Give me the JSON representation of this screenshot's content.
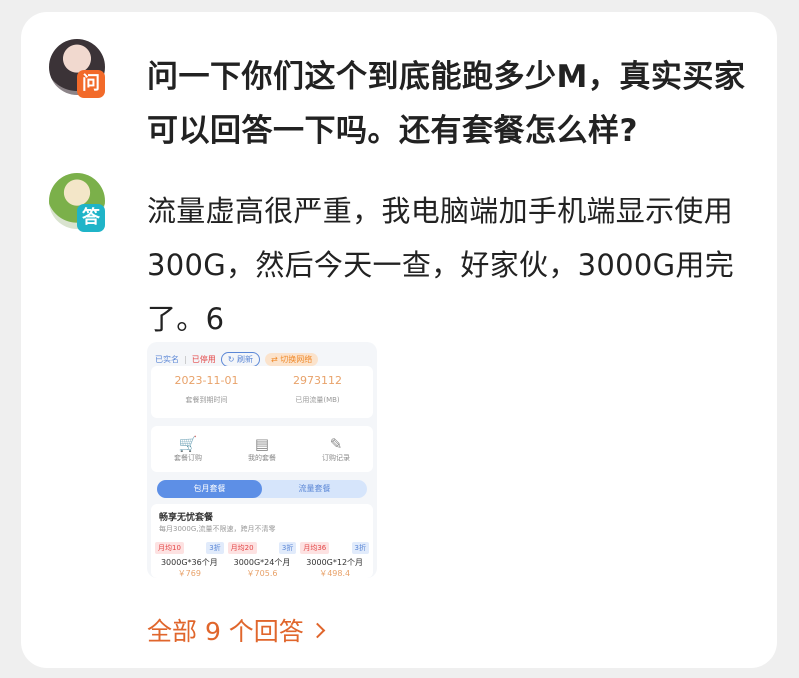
{
  "question": {
    "badge": "问",
    "text": "问一下你们这个到底能跑多少M，真实买家可以回答一下吗。还有套餐怎么样?"
  },
  "answer": {
    "badge": "答",
    "text": "流量虚高很严重，我电脑端加手机端显示使用 300G，然后今天一查，好家伙，3000G用完了。6"
  },
  "screenshot": {
    "status_name": "已实名",
    "status_sep": "|",
    "status_stop": "已停用",
    "refresh": "刷新",
    "switch_network": "切换网络",
    "expiry_value": "2023-11-01",
    "expiry_label": "套餐到期时间",
    "usage_value": "2973112",
    "usage_label": "已用流量(MB)",
    "icons": [
      {
        "glyph": "🛒",
        "label": "套餐订购"
      },
      {
        "glyph": "▤",
        "label": "我的套餐"
      },
      {
        "glyph": "✎",
        "label": "订购记录"
      }
    ],
    "tabs": [
      "包月套餐",
      "流量套餐"
    ],
    "package_title": "畅享无忧套餐",
    "package_sub": "每月3000G,流量不限速，跨月不清零",
    "offers": [
      {
        "tag1": "月均10",
        "tag2": "3折",
        "name": "3000G*36个月",
        "price": "￥769"
      },
      {
        "tag1": "月均20",
        "tag2": "3折",
        "name": "3000G*24个月",
        "price": "￥705.6"
      },
      {
        "tag1": "月均36",
        "tag2": "3折",
        "name": "3000G*12个月",
        "price": "￥498.4"
      }
    ]
  },
  "more_link": "全部 9 个回答"
}
